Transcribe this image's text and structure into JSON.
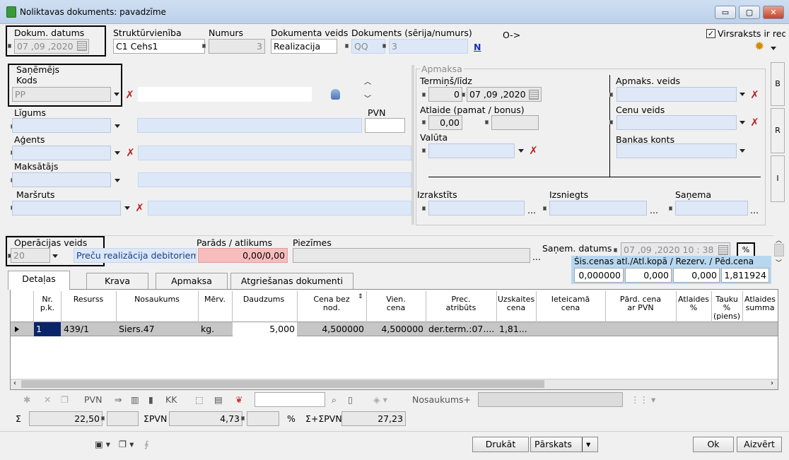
{
  "window": {
    "title": "Noliktavas dokuments: pavadzīme"
  },
  "header": {
    "doc_date_label": "Dokum. datums",
    "doc_date": "07 ,09 ,2020",
    "struct_label": "Struktūrvienība",
    "struct_value": "C1 Cehs1",
    "number_label": "Numurs",
    "number_value": "3",
    "doc_type_label": "Dokumenta veids",
    "doc_type_value": "Realizacija",
    "doc_series_label": "Dokuments (sērija/numurs)",
    "series_value": "QQ",
    "series_number": "3",
    "arrow_text": "O->",
    "n_link": "N",
    "heading_checkbox_label": "Virsraksts ir redz"
  },
  "left": {
    "receiver_label": "Saņēmējs",
    "code_label": "Kods",
    "code_value": "PP",
    "contract_label": "Līgums",
    "vat_label": "PVN",
    "agent_label": "Aģents",
    "payer_label": "Maksātājs",
    "route_label": "Maršruts"
  },
  "payment": {
    "group_label": "Apmaksa",
    "term_label": "Termiņš/līdz",
    "term_days": "0",
    "term_date": "07 ,09 ,2020",
    "discount_label": "Atlaide (pamat / bonus)",
    "discount_value": "0,00",
    "currency_label": "Valūta",
    "pay_type_label": "Apmaks. veids",
    "price_type_label": "Cenu veids",
    "bank_label": "Bankas konts"
  },
  "issue": {
    "issued_label": "Izrakstīts",
    "delivered_label": "Izsniegts",
    "received_label": "Saņema"
  },
  "ops": {
    "op_type_label": "Operācijas veids",
    "op_type_value": "20",
    "op_type_desc": "Preču realizācija debitoriem",
    "debt_label": "Parāds / atlikums",
    "debt_value": "0,00/0,00",
    "notes_label": "Piezīmes",
    "recv_date_label": "Saņem. datums",
    "recv_date": "07 ,09 ,2020 10 : 38",
    "summary_label": "Šis.cenas atl./Atl.kopā / Rezerv. / Pēd.cena",
    "summary_values": [
      "0,000000",
      "0,000",
      "0,000",
      "1,811924"
    ]
  },
  "tabs": [
    "Detaļas",
    "Krava",
    "Apmaksa",
    "Atgriešanas dokumenti"
  ],
  "side_tabs": [
    "B",
    "R",
    "I"
  ],
  "table": {
    "headers": [
      "Nr.\np.k.",
      "Resurss",
      "Nosaukums",
      "Mērv.",
      "Daudzums",
      "Cena bez\nnod.",
      "Vien.\ncena",
      "Prec.\natribūts",
      "Uzskaites\ncena",
      "Ieteicamā\ncena",
      "Pārd. cena\nar PVN",
      "Atlaides\n%",
      "Tauku\n%\n(piens)",
      "Atlaides\nsumma"
    ],
    "rows": [
      [
        "1",
        "439/1",
        "Siers.47",
        "kg.",
        "5,000",
        "4,500000",
        "4,500000",
        "der.term.:07....",
        "1,81..."
      ]
    ]
  },
  "toolbar": {
    "pvn": "PVN",
    "kk": "KK",
    "name_plus": "Nosaukums+"
  },
  "totals": {
    "sigma": "Σ",
    "sum": "22,50",
    "spvn_label": "ΣPVN",
    "spvn": "4,73",
    "pct": "%",
    "total_label": "Σ+ΣPVN",
    "total": "27,23"
  },
  "footer": {
    "print": "Drukāt",
    "reports": "Pārskats",
    "ok": "Ok",
    "cancel": "Aizvērt"
  }
}
